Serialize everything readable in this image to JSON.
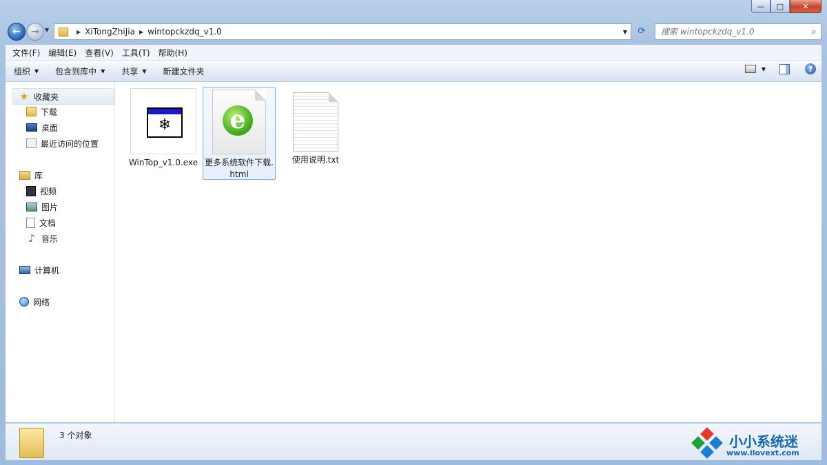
{
  "window": {
    "minimize": "—",
    "maximize": "□",
    "close": "✕"
  },
  "address": {
    "crumbs": [
      "XiTongZhiJia",
      "wintopckzdq_v1.0"
    ]
  },
  "search": {
    "placeholder": "搜索 wintopckzdq_v1.0"
  },
  "menu": [
    "文件(F)",
    "编辑(E)",
    "查看(V)",
    "工具(T)",
    "帮助(H)"
  ],
  "commands": {
    "organize": "组织",
    "include": "包含到库中",
    "share": "共享",
    "new_folder": "新建文件夹"
  },
  "nav": {
    "favorites": "收藏夹",
    "downloads": "下载",
    "desktop": "桌面",
    "recent": "最近访问的位置",
    "libraries": "库",
    "videos": "视频",
    "pictures": "图片",
    "documents": "文档",
    "music": "音乐",
    "computer": "计算机",
    "network": "网络"
  },
  "files": [
    {
      "name": "WinTop_v1.0.exe",
      "icon": "exe-window-icon"
    },
    {
      "name": "更多系统软件下载.html",
      "icon": "ie-html-icon"
    },
    {
      "name": "使用说明.txt",
      "icon": "text-document-icon"
    }
  ],
  "status": {
    "count": "3 个对象"
  },
  "watermark": {
    "title": "小小系统迷",
    "url": "www.ilovext.com",
    "colors": [
      "#e43b2c",
      "#2a9d3a",
      "#1e7fd0"
    ]
  }
}
